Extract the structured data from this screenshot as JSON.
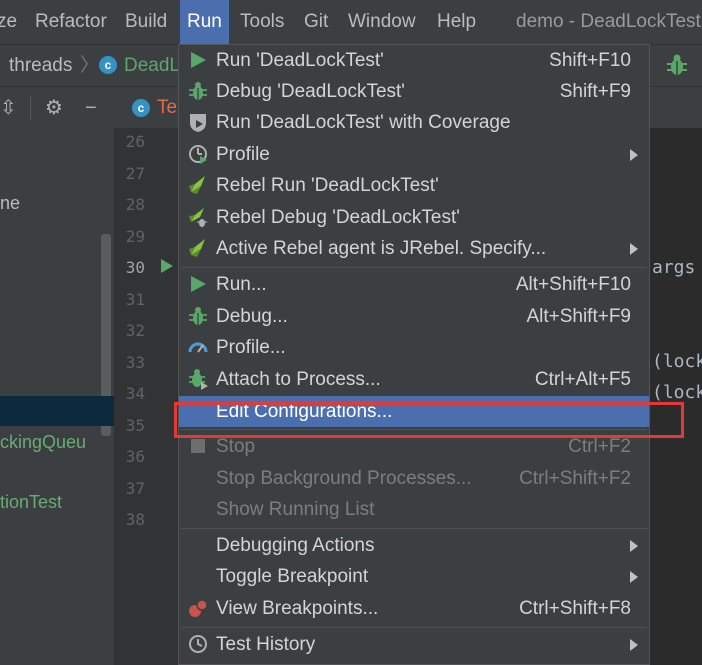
{
  "menubar": {
    "items": [
      "ze",
      "Refactor",
      "Build",
      "Run",
      "Tools",
      "Git",
      "Window",
      "Help"
    ],
    "window_title": "demo - DeadLockTest"
  },
  "navbar": {
    "crumb_folder": "threads",
    "crumb_class": "DeadL"
  },
  "editor": {
    "tab_label": "Te",
    "line_numbers": [
      "26",
      "27",
      "28",
      "29",
      "30",
      "31",
      "32",
      "33",
      "34",
      "35",
      "36",
      "37",
      "38"
    ],
    "code_fragments": {
      "line30": "args",
      "line33": "(lock",
      "line34": "(lock"
    }
  },
  "project": {
    "rows": [
      "ne",
      "ckingQueu",
      "tionTest"
    ]
  },
  "run_menu": {
    "items": [
      {
        "icon": "run-icon",
        "label": "Run 'DeadLockTest'",
        "shortcut": "Shift+F10"
      },
      {
        "icon": "debug-icon",
        "label": "Debug 'DeadLockTest'",
        "shortcut": "Shift+F9"
      },
      {
        "icon": "coverage-icon",
        "label": "Run 'DeadLockTest' with Coverage",
        "shortcut": ""
      },
      {
        "icon": "profile-icon",
        "label": "Profile",
        "shortcut": ""
      },
      {
        "icon": "rebel-run-icon",
        "label": "Rebel Run 'DeadLockTest'",
        "shortcut": ""
      },
      {
        "icon": "rebel-debug-icon",
        "label": "Rebel Debug 'DeadLockTest'",
        "shortcut": ""
      },
      {
        "icon": "rebel-agent-icon",
        "label": "Active Rebel agent is JRebel. Specify...",
        "shortcut": ""
      },
      {
        "icon": "run-icon",
        "label": "Run...",
        "shortcut": "Alt+Shift+F10"
      },
      {
        "icon": "debug-icon",
        "label": "Debug...",
        "shortcut": "Alt+Shift+F9"
      },
      {
        "icon": "profiler-gauge-icon",
        "label": "Profile...",
        "shortcut": ""
      },
      {
        "icon": "attach-process-icon",
        "label": "Attach to Process...",
        "shortcut": "Ctrl+Alt+F5"
      },
      {
        "icon": "",
        "label": "Edit Configurations...",
        "shortcut": ""
      },
      {
        "icon": "stop-icon",
        "label": "Stop",
        "shortcut": "Ctrl+F2"
      },
      {
        "icon": "",
        "label": "Stop Background Processes...",
        "shortcut": "Ctrl+Shift+F2"
      },
      {
        "icon": "",
        "label": "Show Running List",
        "shortcut": ""
      },
      {
        "icon": "",
        "label": "Debugging Actions",
        "shortcut": ""
      },
      {
        "icon": "",
        "label": "Toggle Breakpoint",
        "shortcut": ""
      },
      {
        "icon": "breakpoints-icon",
        "label": "View Breakpoints...",
        "shortcut": "Ctrl+Shift+F8"
      },
      {
        "icon": "history-clock-icon",
        "label": "Test History",
        "shortcut": ""
      }
    ]
  },
  "colors": {
    "menu_bg": "#3c3f41",
    "highlight": "#4b6eaf",
    "run_green": "#59a869",
    "annotation_red": "#e53935"
  }
}
